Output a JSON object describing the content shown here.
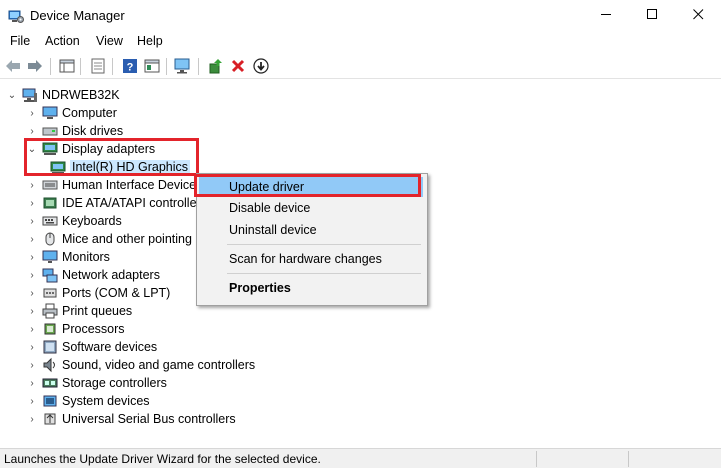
{
  "window": {
    "title": "Device Manager"
  },
  "title_controls": {
    "minimize": "—",
    "maximize": "☐",
    "close": "✕"
  },
  "menu": [
    "File",
    "Action",
    "View",
    "Help"
  ],
  "toolbar": {
    "icons": [
      "back-icon",
      "forward-icon",
      "show-hide-console-tree-icon",
      "properties-icon",
      "help-icon",
      "view-icon",
      "scan-hardware-icon",
      "update-driver-icon",
      "uninstall-icon",
      "disable-icon"
    ]
  },
  "tree": {
    "root": "NDRWEB32K",
    "categories": [
      {
        "label": "Computer",
        "icon": "computer-icon",
        "expanded": false
      },
      {
        "label": "Disk drives",
        "icon": "disk-drive-icon",
        "expanded": false
      },
      {
        "label": "Display adapters",
        "icon": "display-adapter-icon",
        "expanded": true,
        "children": [
          {
            "label": "Intel(R) HD Graphics",
            "icon": "display-adapter-icon",
            "selected": true
          }
        ]
      },
      {
        "label": "Human Interface Device",
        "icon": "hid-icon",
        "expanded": false
      },
      {
        "label": "IDE ATA/ATAPI controller",
        "icon": "ide-controller-icon",
        "expanded": false
      },
      {
        "label": "Keyboards",
        "icon": "keyboard-icon",
        "expanded": false
      },
      {
        "label": "Mice and other pointing",
        "icon": "mouse-icon",
        "expanded": false
      },
      {
        "label": "Monitors",
        "icon": "monitor-icon",
        "expanded": false
      },
      {
        "label": "Network adapters",
        "icon": "network-adapter-icon",
        "expanded": false
      },
      {
        "label": "Ports (COM & LPT)",
        "icon": "port-icon",
        "expanded": false
      },
      {
        "label": "Print queues",
        "icon": "printer-icon",
        "expanded": false
      },
      {
        "label": "Processors",
        "icon": "processor-icon",
        "expanded": false
      },
      {
        "label": "Software devices",
        "icon": "software-device-icon",
        "expanded": false
      },
      {
        "label": "Sound, video and game controllers",
        "icon": "sound-icon",
        "expanded": false
      },
      {
        "label": "Storage controllers",
        "icon": "storage-controller-icon",
        "expanded": false
      },
      {
        "label": "System devices",
        "icon": "system-device-icon",
        "expanded": false
      },
      {
        "label": "Universal Serial Bus controllers",
        "icon": "usb-icon",
        "expanded": false
      }
    ]
  },
  "context_menu": {
    "items": [
      "Update driver",
      "Disable device",
      "Uninstall device",
      "Scan for hardware changes",
      "Properties"
    ],
    "highlighted": "Update driver"
  },
  "status_bar": {
    "text": "Launches the Update Driver Wizard for the selected device."
  },
  "colors": {
    "highlight_box": "#e3242b",
    "selection": "#cce8ff",
    "menu_hover": "#91c9f7",
    "status_bg": "#f0f0f0"
  }
}
